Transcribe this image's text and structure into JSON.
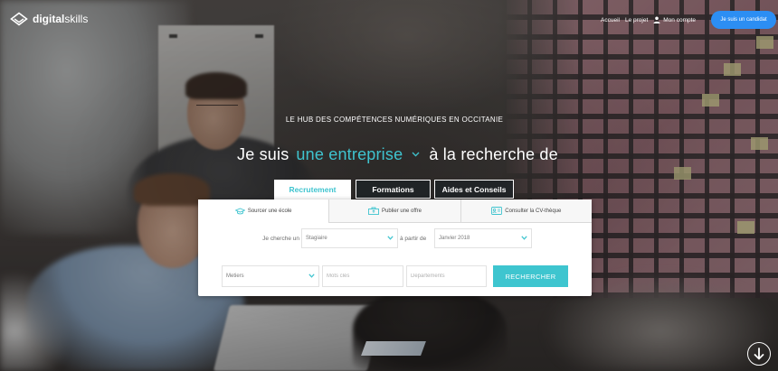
{
  "header": {
    "logo": {
      "part1": "digital",
      "part2": "skills",
      "icon": "logo-icon"
    },
    "nav": {
      "home": "Accueil",
      "project": "Le projet",
      "account": "Mon compte",
      "account_icon": "user-icon",
      "cta": "Je suis un candidat"
    }
  },
  "hero": {
    "tagline": "LE HUB DES COMPÉTENCES NUMÉRIQUES EN OCCITANIE",
    "headline_prefix": "Je suis",
    "profile_selected": "une entreprise",
    "profile_icon": "chevron-down-icon",
    "headline_suffix": "à la recherche de"
  },
  "tabs": [
    {
      "label": "Recrutement",
      "active": true
    },
    {
      "label": "Formations",
      "active": false
    },
    {
      "label": "Aides et Conseils",
      "active": false
    }
  ],
  "subtabs": [
    {
      "label": "Sourcer une école",
      "icon": "graduation-cap-icon",
      "active": true
    },
    {
      "label": "Publier une offre",
      "icon": "briefcase-icon",
      "active": false
    },
    {
      "label": "Consulter la CV-thèque",
      "icon": "id-card-icon",
      "active": false
    }
  ],
  "search": {
    "looking_for_label": "Je cherche un",
    "looking_for_value": "Stagiaire",
    "from_label": "à partir de",
    "from_value": "Janvier 2018",
    "job_value": "Metiers",
    "keywords_placeholder": "Mots clés",
    "departments_placeholder": "Departements",
    "submit_label": "RECHERCHER",
    "select_icon": "chevron-down-icon"
  },
  "scroll_icon": "arrow-down-icon",
  "colors": {
    "accent": "#3fc4cf",
    "cta": "#2c8ef3",
    "button": "#3ec5cf"
  }
}
